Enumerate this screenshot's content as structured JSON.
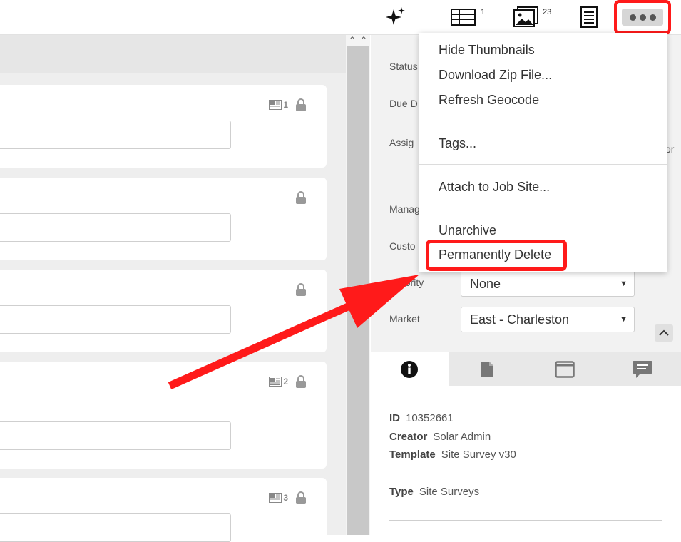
{
  "toolbar": {
    "sparkle_icon": "sparkle-icon",
    "table_count": "1",
    "images_count": "23",
    "document_icon": "document-icon",
    "more_icon": "more-dots-icon"
  },
  "cards": [
    {
      "thumb_count": "1",
      "has_thumb": true
    },
    {
      "thumb_count": "",
      "has_thumb": false
    },
    {
      "thumb_count": "",
      "has_thumb": false
    },
    {
      "thumb_count": "2",
      "has_thumb": true
    },
    {
      "thumb_count": "3",
      "has_thumb": true
    }
  ],
  "menu": {
    "hide_thumbnails": "Hide Thumbnails",
    "download_zip": "Download Zip File...",
    "refresh_geocode": "Refresh Geocode",
    "tags": "Tags...",
    "attach_job_site": "Attach to Job Site...",
    "unarchive": "Unarchive",
    "permanently_delete": "Permanently Delete"
  },
  "properties": {
    "status_label": "Status",
    "due_date_label": "Due D",
    "assigned_label": "Assig",
    "assigned_suffix": "or",
    "manager_label": "Manag",
    "customer_label": "Custo",
    "priority_label": "riority",
    "priority_value": "None",
    "market_label": "Market",
    "market_value": "East - Charleston"
  },
  "details": {
    "id_label": "ID",
    "id_value": "10352661",
    "creator_label": "Creator",
    "creator_value": "Solar Admin",
    "template_label": "Template",
    "template_value": "Site Survey v30",
    "type_label": "Type",
    "type_value": "Site Surveys"
  },
  "colors": {
    "highlight": "#ff1a1a",
    "arrow": "#ff1a1a"
  }
}
